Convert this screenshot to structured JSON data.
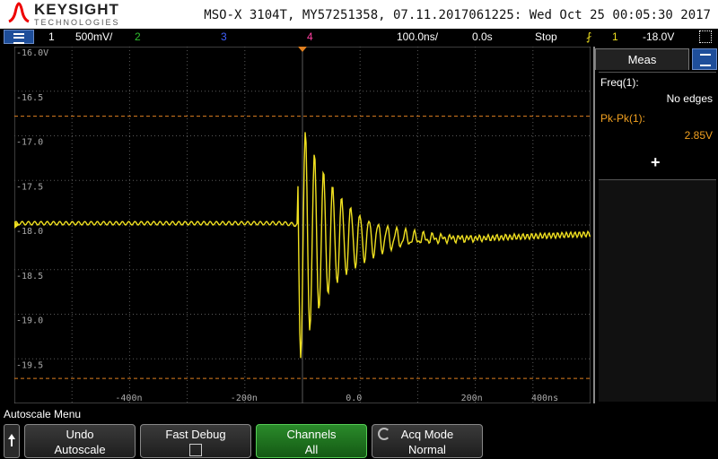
{
  "header": {
    "brand": "KEYSIGHT",
    "sub": "TECHNOLOGIES",
    "info": "MSO-X 3104T, MY57251358, 07.11.2017061225: Wed Oct 25 00:05:30 2017"
  },
  "status": {
    "ch1": "1",
    "scale": "500mV/",
    "ch2": "2",
    "ch3": "3",
    "ch4": "4",
    "timebase": "100.0ns/",
    "delay": "0.0s",
    "run_state": "Stop",
    "trig_source": "1",
    "trig_level": "-18.0V"
  },
  "colors": {
    "ch1": "#f0e020",
    "ch2": "#30c030",
    "ch3": "#4060ff",
    "ch4": "#ff40a0",
    "cursor": "#e08020",
    "grid": "#5a5a5a"
  },
  "plot": {
    "y_labels": [
      "-16.0V",
      "-16.5",
      "-17.0",
      "-17.5",
      "-18.0",
      "-18.5",
      "-19.0",
      "-19.5"
    ],
    "x_labels": [
      "-400n",
      "-200n",
      "0.0",
      "200n",
      "400ns"
    ],
    "cursor_high": -16.78,
    "cursor_low": -19.72
  },
  "measurements": {
    "tab": "Meas",
    "items": [
      {
        "label": "Freq(1):",
        "value": "No edges"
      },
      {
        "label": "Pk-Pk(1):",
        "value": "2.85V"
      }
    ],
    "add": "+"
  },
  "softkeys": {
    "title": "Autoscale Menu",
    "undo": [
      "Undo",
      "Autoscale"
    ],
    "debug": [
      "Fast Debug"
    ],
    "channels": [
      "Channels",
      "All"
    ],
    "acq": [
      "Acq Mode",
      "Normal"
    ]
  }
}
